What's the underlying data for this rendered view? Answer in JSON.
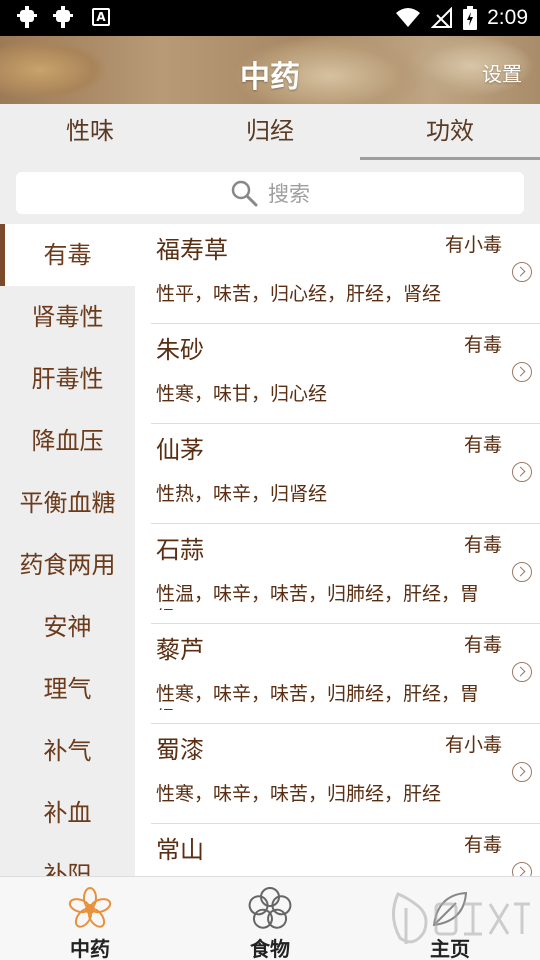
{
  "status_bar": {
    "time": "2:09"
  },
  "header": {
    "title": "中药",
    "settings_label": "设置"
  },
  "tabs": [
    {
      "label": "性味"
    },
    {
      "label": "归经"
    },
    {
      "label": "功效"
    }
  ],
  "search": {
    "placeholder": "搜索"
  },
  "sidebar": {
    "items": [
      {
        "label": "有毒"
      },
      {
        "label": "肾毒性"
      },
      {
        "label": "肝毒性"
      },
      {
        "label": "降血压"
      },
      {
        "label": "平衡血糖"
      },
      {
        "label": "药食两用"
      },
      {
        "label": "安神"
      },
      {
        "label": "理气"
      },
      {
        "label": "补气"
      },
      {
        "label": "补血"
      },
      {
        "label": "补阳"
      }
    ]
  },
  "list": {
    "items": [
      {
        "name": "福寿草",
        "toxicity": "有小毒",
        "desc": "性平，味苦，归心经，肝经，肾经"
      },
      {
        "name": "朱砂",
        "toxicity": "有毒",
        "desc": "性寒，味甘，归心经"
      },
      {
        "name": "仙茅",
        "toxicity": "有毒",
        "desc": "性热，味辛，归肾经"
      },
      {
        "name": "石蒜",
        "toxicity": "有毒",
        "desc": "性温，味辛，味苦，归肺经，肝经，胃经"
      },
      {
        "name": "藜芦",
        "toxicity": "有毒",
        "desc": "性寒，味辛，味苦，归肺经，肝经，胃经"
      },
      {
        "name": "蜀漆",
        "toxicity": "有小毒",
        "desc": "性寒，味辛，味苦，归肺经，肝经"
      },
      {
        "name": "常山",
        "toxicity": "有毒",
        "desc": ""
      }
    ]
  },
  "bottom_nav": {
    "items": [
      {
        "label": "中药"
      },
      {
        "label": "食物"
      },
      {
        "label": "主页"
      }
    ]
  },
  "colors": {
    "accent": "#7a4a2a",
    "text": "#5a2e12",
    "icon_active": "#e8913a"
  }
}
